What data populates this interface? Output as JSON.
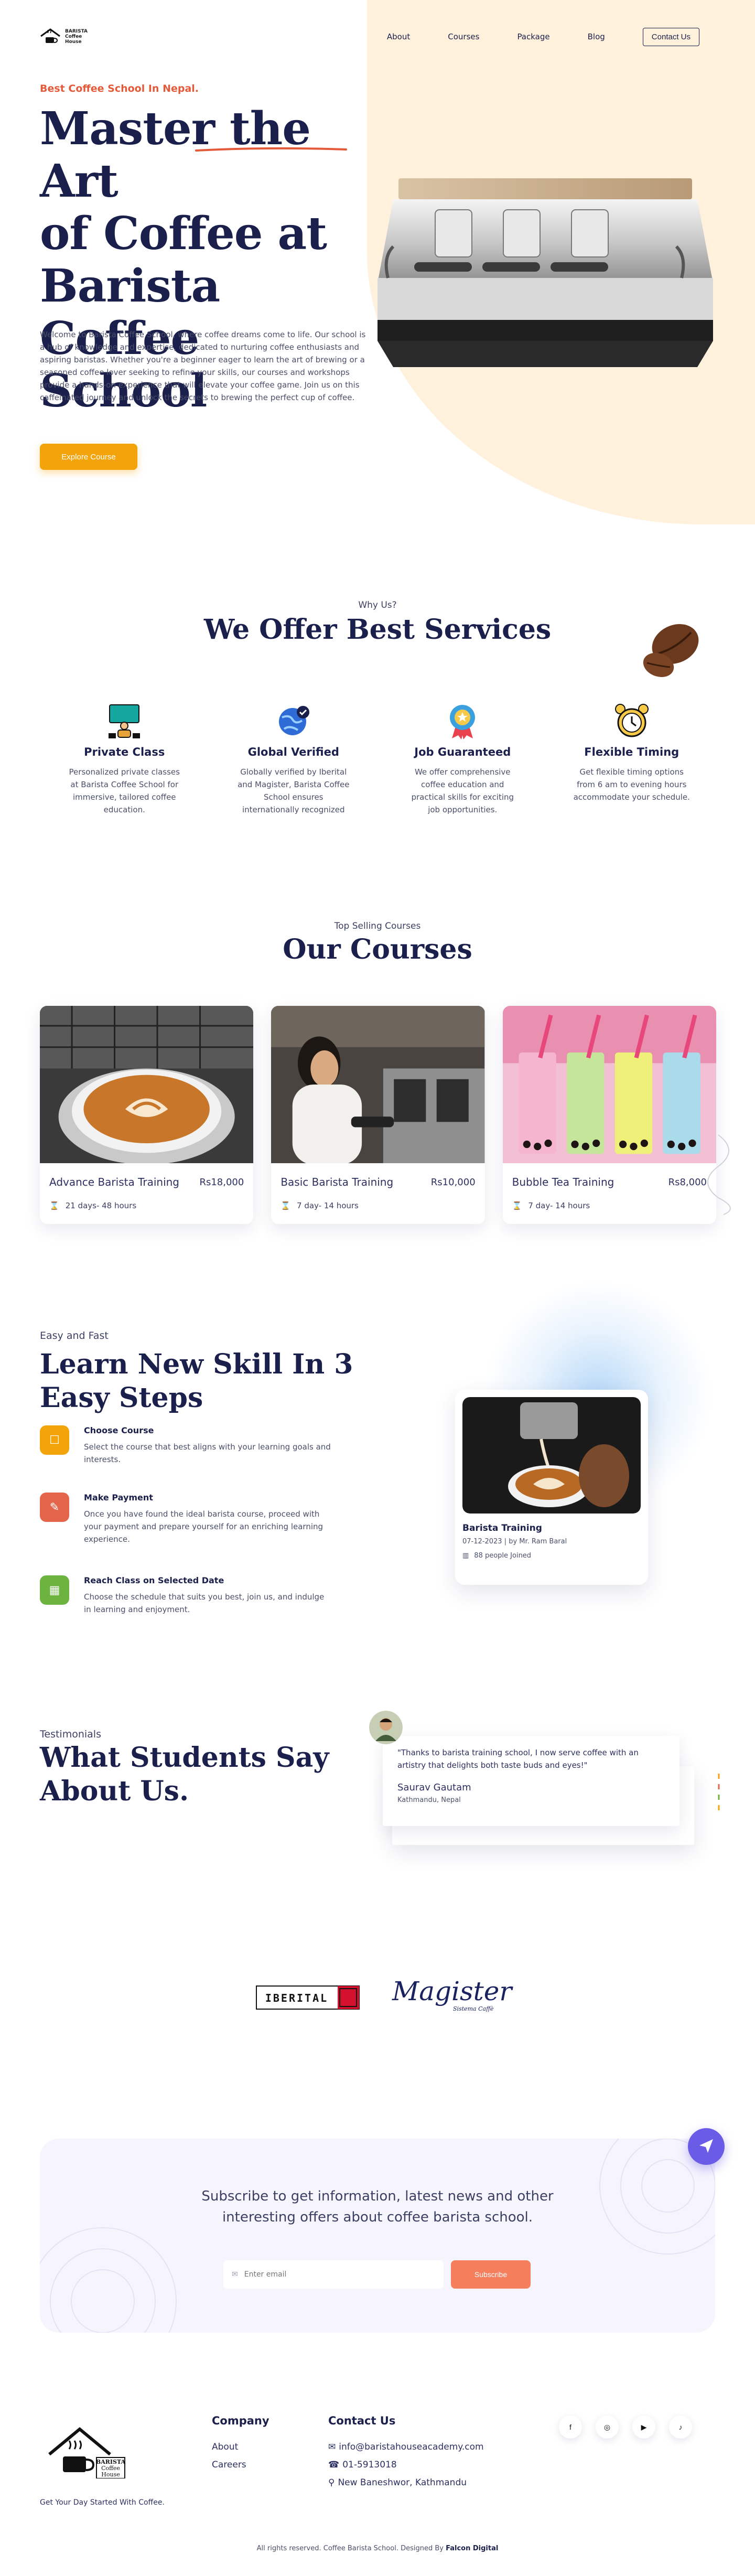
{
  "nav": {
    "logo_lines": [
      "BARISTA",
      "Coffee",
      "House"
    ],
    "links": [
      "About",
      "Courses",
      "Package",
      "Blog"
    ],
    "contact": "Contact Us"
  },
  "hero": {
    "kicker": "Best Coffee School In Nepal.",
    "title_lines": [
      "Master the Art",
      "of Coffee at",
      "Barista Coffee",
      "School"
    ],
    "description": "Welcome to Barista Coffee School, where coffee dreams come to life. Our school is a hub of knowledge and expertise, dedicated to nurturing coffee enthusiasts and aspiring baristas. Whether you're a beginner eager to learn the art of brewing or a seasoned coffee lover seeking to refine your skills, our courses and workshops provide a hands-on experience that will elevate your coffee game. Join us on this caffeinated journey and unlock the secrets to brewing the perfect cup of coffee.",
    "button": "Explore Course"
  },
  "services": {
    "kicker": "Why Us?",
    "title": "We Offer Best Services",
    "items": [
      {
        "icon": "teacher-icon",
        "title": "Private Class",
        "text": "Personalized private classes at Barista Coffee School for immersive, tailored coffee education."
      },
      {
        "icon": "globe-icon",
        "title": "Global Verified",
        "text": "Globally verified by Iberital and Magister, Barista Coffee School ensures internationally recognized"
      },
      {
        "icon": "badge-icon",
        "title": "Job Guaranteed",
        "text": "We offer comprehensive coffee education and practical skills for exciting job opportunities."
      },
      {
        "icon": "alarm-clock-icon",
        "title": "Flexible Timing",
        "text": "Get flexible timing options from 6 am to evening hours accommodate your schedule."
      }
    ]
  },
  "courses": {
    "kicker": "Top Selling Courses",
    "title": "Our Courses",
    "items": [
      {
        "name": "Advance Barista Training",
        "price": "Rs18,000",
        "duration": "21 days- 48 hours"
      },
      {
        "name": "Basic Barista Training",
        "price": "Rs10,000",
        "duration": "7 day- 14 hours"
      },
      {
        "name": "Bubble Tea Training",
        "price": "Rs8,000",
        "duration": "7 day- 14 hours"
      }
    ]
  },
  "steps": {
    "kicker": "Easy and Fast",
    "title_lines": [
      "Learn New Skill In 3",
      "Easy Steps"
    ],
    "items": [
      {
        "title": "Choose Course",
        "text": "Select the course that best aligns with your learning goals and interests.",
        "color": "#f3a40b"
      },
      {
        "title": "Make Payment",
        "text": "Once you have found the ideal barista course, proceed with your payment and prepare yourself for an enriching learning experience.",
        "color": "#e5654b"
      },
      {
        "title": "Reach Class on Selected Date",
        "text": "Choose the schedule that suits you best, join us, and indulge in learning and enjoyment.",
        "color": "#6cb33f"
      }
    ],
    "event": {
      "title": "Barista Training",
      "meta": "07-12-2023 | by Mr. Ram Baral",
      "joined": "88 people Joined"
    }
  },
  "testimonials": {
    "kicker": "Testimonials",
    "title_lines": [
      "What Students Say",
      "About Us."
    ],
    "quote": "\"Thanks to barista training school, I now serve coffee with an artistry that delights both taste buds and eyes!\"",
    "name": "Saurav Gautam",
    "location": "Kathmandu, Nepal"
  },
  "partners": {
    "iberital": "IBERITAL",
    "magister": "Magister",
    "magister_sub": "Sistema Caffè"
  },
  "newsletter": {
    "text_lines": [
      "Subscribe to get information, latest news and other",
      "interesting offers about coffee barista school."
    ],
    "placeholder": "Enter email",
    "button": "Subscribe"
  },
  "footer": {
    "tagline": "Get Your Day Started With Coffee.",
    "company_title": "Company",
    "company_links": [
      "About",
      "Careers"
    ],
    "contact_title": "Contact Us",
    "email": "info@baristahouseacademy.com",
    "phone": "01-5913018",
    "address": "New Baneshwor, Kathmandu",
    "socials": [
      "f",
      "◎",
      "▶",
      "♪"
    ],
    "copyright_prefix": "All rights reserved. Coffee Barista School. Designed By",
    "copyright_brand": "Falcon Digital"
  },
  "colors": {
    "navy": "#1a1f4b",
    "accent_orange": "#f3a40b",
    "kicker_red": "#e35a3a",
    "subscribe": "#f57e5d",
    "fab": "#6b5ce7"
  }
}
